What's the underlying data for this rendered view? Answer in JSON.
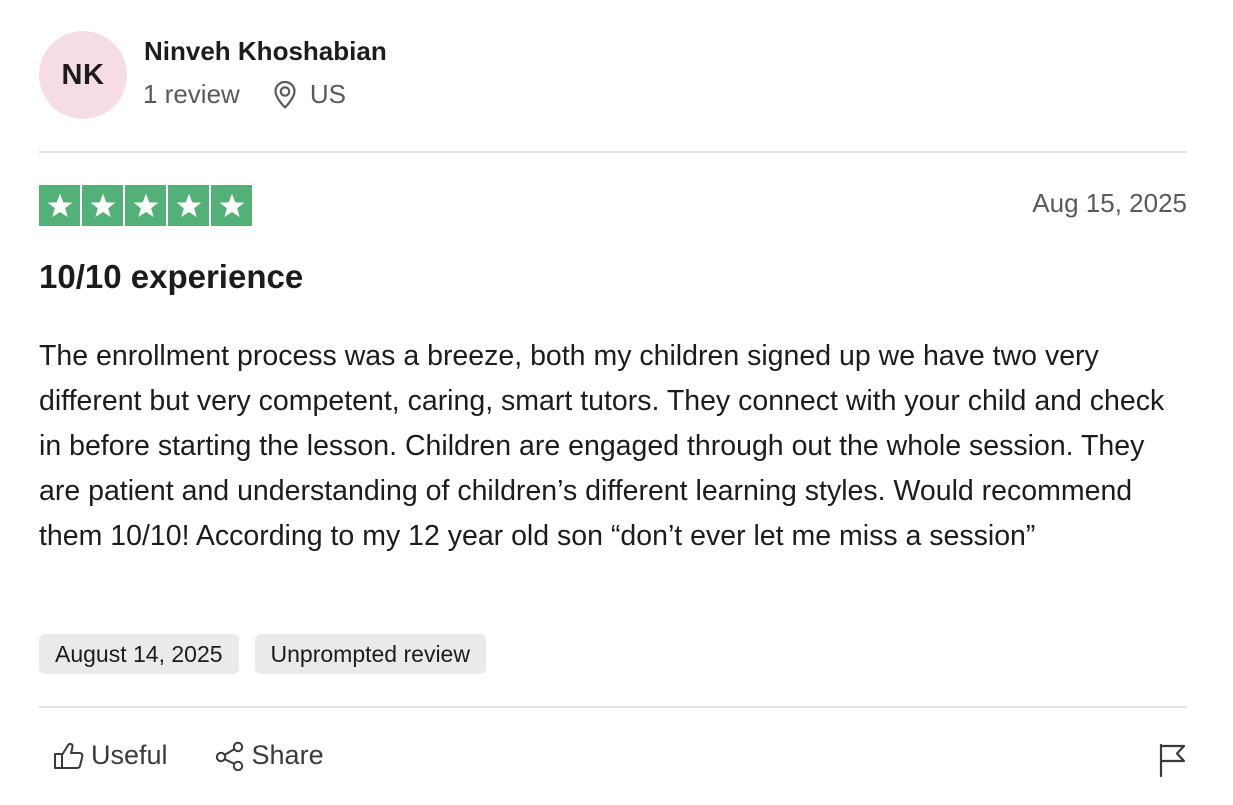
{
  "reviewer": {
    "initials": "NK",
    "name": "Ninveh Khoshabian",
    "review_count": "1 review",
    "location": "US",
    "avatar_color": "#f6dde5"
  },
  "review": {
    "rating": 5,
    "rating_max": 5,
    "star_color": "#53b178",
    "date": "Aug 15, 2025",
    "title": "10/10 experience",
    "body": "The enrollment process was a breeze, both my children signed up we have two very different but very competent, caring, smart tutors. They connect with your child and check in before starting the lesson. Children are engaged through out the whole session. They are patient and understanding of children’s different learning styles. Would recommend them 10/10! According to my 12 year old son “don’t ever let me miss a session”",
    "experience_date": "August 14, 2025",
    "review_type": "Unprompted review"
  },
  "actions": {
    "useful_label": "Useful",
    "share_label": "Share",
    "useful_icon": "thumbs-up-icon",
    "share_icon": "share-icon",
    "report_icon": "flag-icon",
    "location_icon": "map-pin-icon"
  }
}
